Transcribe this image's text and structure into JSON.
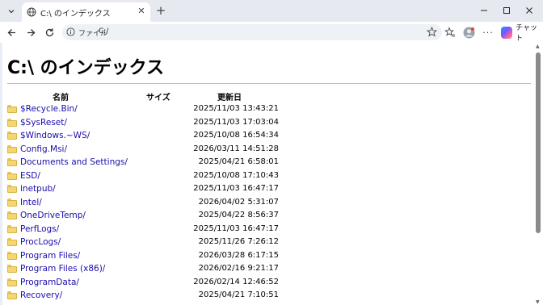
{
  "tab": {
    "title": "C:\\ のインデックス"
  },
  "address": {
    "label": "ファイル",
    "url": "C:/"
  },
  "toolbar": {
    "chat_label": "チャット"
  },
  "page": {
    "title": "C:\\ のインデックス",
    "columns": {
      "name": "名前",
      "size": "サイズ",
      "modified": "更新日"
    }
  },
  "entries": [
    {
      "name": "$Recycle.Bin/",
      "date": "2025/11/03 13:43:21"
    },
    {
      "name": "$SysReset/",
      "date": "2025/11/03 17:03:04"
    },
    {
      "name": "$Windows.~WS/",
      "date": "2025/10/08 16:54:34"
    },
    {
      "name": "Config.Msi/",
      "date": "2026/03/11 14:51:28"
    },
    {
      "name": "Documents and Settings/",
      "date": "2025/04/21 6:58:01"
    },
    {
      "name": "ESD/",
      "date": "2025/10/08 17:10:43"
    },
    {
      "name": "inetpub/",
      "date": "2025/11/03 16:47:17"
    },
    {
      "name": "Intel/",
      "date": "2026/04/02 5:31:07"
    },
    {
      "name": "OneDriveTemp/",
      "date": "2025/04/22 8:56:37"
    },
    {
      "name": "PerfLogs/",
      "date": "2025/11/03 16:47:17"
    },
    {
      "name": "ProcLogs/",
      "date": "2025/11/26 7:26:12"
    },
    {
      "name": "Program Files/",
      "date": "2026/03/28 6:17:15"
    },
    {
      "name": "Program Files (x86)/",
      "date": "2026/02/16 9:21:17"
    },
    {
      "name": "ProgramData/",
      "date": "2026/02/14 12:46:52"
    },
    {
      "name": "Recovery/",
      "date": "2025/04/21 7:10:51"
    }
  ]
}
